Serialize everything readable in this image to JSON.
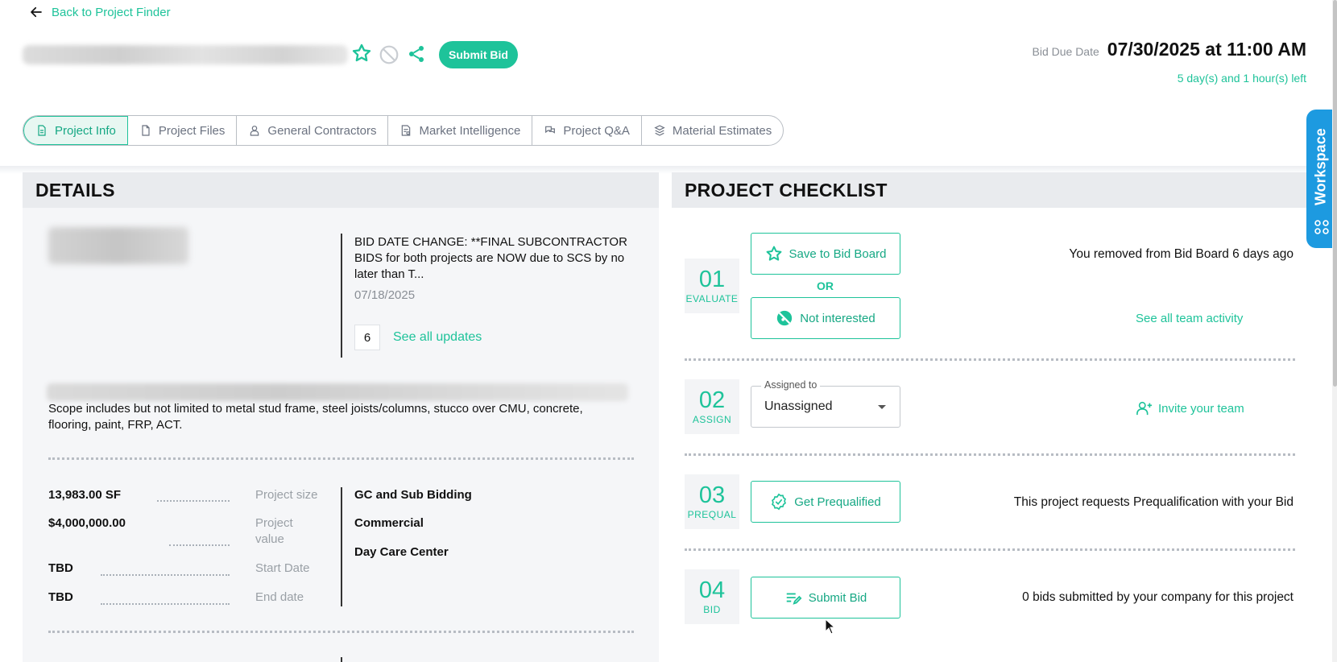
{
  "nav": {
    "back_label": "Back to Project Finder"
  },
  "header": {
    "submit_bid_label": "Submit Bid",
    "bid_due_label": "Bid Due Date",
    "bid_due_value": "07/30/2025 at 11:00 AM",
    "time_left": "5 day(s) and 1 hour(s) left"
  },
  "tabs": [
    {
      "label": "Project Info",
      "icon": "document-icon",
      "active": true
    },
    {
      "label": "Project Files",
      "icon": "file-icon"
    },
    {
      "label": "General Contractors",
      "icon": "person-icon"
    },
    {
      "label": "Market Intelligence",
      "icon": "report-icon"
    },
    {
      "label": "Project Q&A",
      "icon": "chat-icon"
    },
    {
      "label": "Material Estimates",
      "icon": "estimate-icon"
    }
  ],
  "details": {
    "heading": "DETAILS",
    "update_text": "BID DATE CHANGE: **FINAL SUBCONTRACTOR BIDS for both projects are NOW due to SCS by no later than T...",
    "update_date": "07/18/2025",
    "update_count": "6",
    "see_all_updates": "See all updates",
    "scope": "Scope includes but not limited to metal stud frame, steel joists/columns, stucco over CMU, concrete, flooring, paint, FRP, ACT.",
    "facts": [
      {
        "value": "13,983.00 SF",
        "label": "Project size"
      },
      {
        "value": "$4,000,000.00",
        "label": "Project value"
      },
      {
        "value": "TBD",
        "label": "Start Date"
      },
      {
        "value": "TBD",
        "label": "End date"
      }
    ],
    "attributes": [
      "GC and Sub Bidding",
      "Commercial",
      "Day Care Center"
    ]
  },
  "checklist": {
    "heading": "PROJECT CHECKLIST",
    "steps": [
      {
        "num": "01",
        "label": "EVALUATE"
      },
      {
        "num": "02",
        "label": "ASSIGN"
      },
      {
        "num": "03",
        "label": "PREQUAL"
      },
      {
        "num": "04",
        "label": "BID"
      }
    ],
    "save_label": "Save to Bid Board",
    "or_label": "OR",
    "not_interested_label": "Not interested",
    "removed_text": "You removed from Bid Board 6 days ago",
    "team_activity": "See all team activity",
    "assigned_to_label": "Assigned to",
    "assigned_value": "Unassigned",
    "invite_label": "Invite your team",
    "prequal_label": "Get Prequalified",
    "prequal_text": "This project requests Prequalification with your Bid",
    "submit_label": "Submit Bid",
    "bids_text": "0 bids submitted by your company for this project"
  },
  "workspace": {
    "label": "Workspace"
  },
  "colors": {
    "accent": "#1ec39a",
    "workspace": "#1d9ae0"
  }
}
